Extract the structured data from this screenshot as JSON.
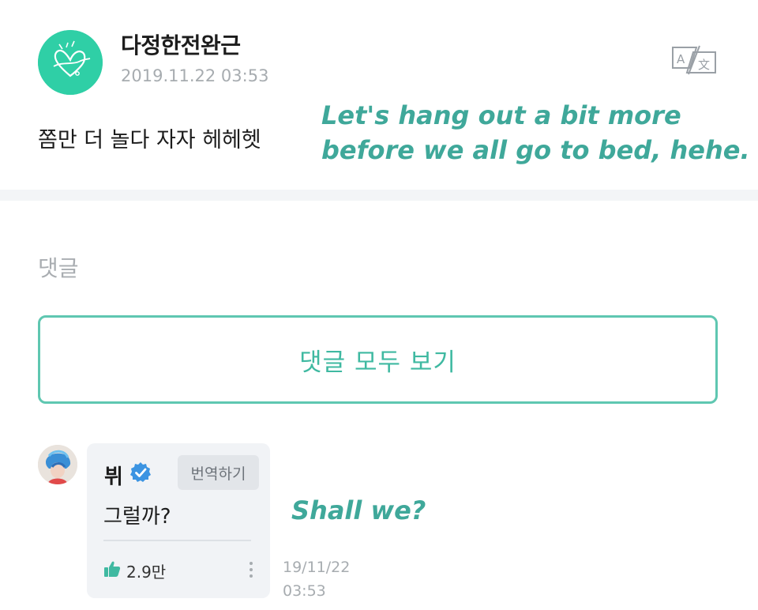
{
  "post": {
    "author": "다정한전완근",
    "time": "2019.11.22 03:53",
    "text": "쫌만 더 놀다 자자 헤헤헷",
    "translation_note_line1": "Let's hang out a bit more",
    "translation_note_line2": "before we all go to bed, hehe."
  },
  "comments": {
    "title": "댓글",
    "view_all_label": "댓글 모두 보기",
    "items": [
      {
        "name": "뷔",
        "verified": true,
        "translate_label": "번역하기",
        "text": "그럴까?",
        "likes": "2.9만",
        "date": "19/11/22",
        "time": "03:53",
        "translation_note": "Shall we?"
      }
    ]
  },
  "colors": {
    "accent": "#3fb9a1",
    "annotation": "#3fa89a",
    "muted": "#a7acb0",
    "card": "#f1f3f6"
  },
  "icons": {
    "translate": "translate-icon",
    "verified": "verified-badge-icon",
    "like": "thumbs-up-icon",
    "more": "more-vertical-icon"
  }
}
